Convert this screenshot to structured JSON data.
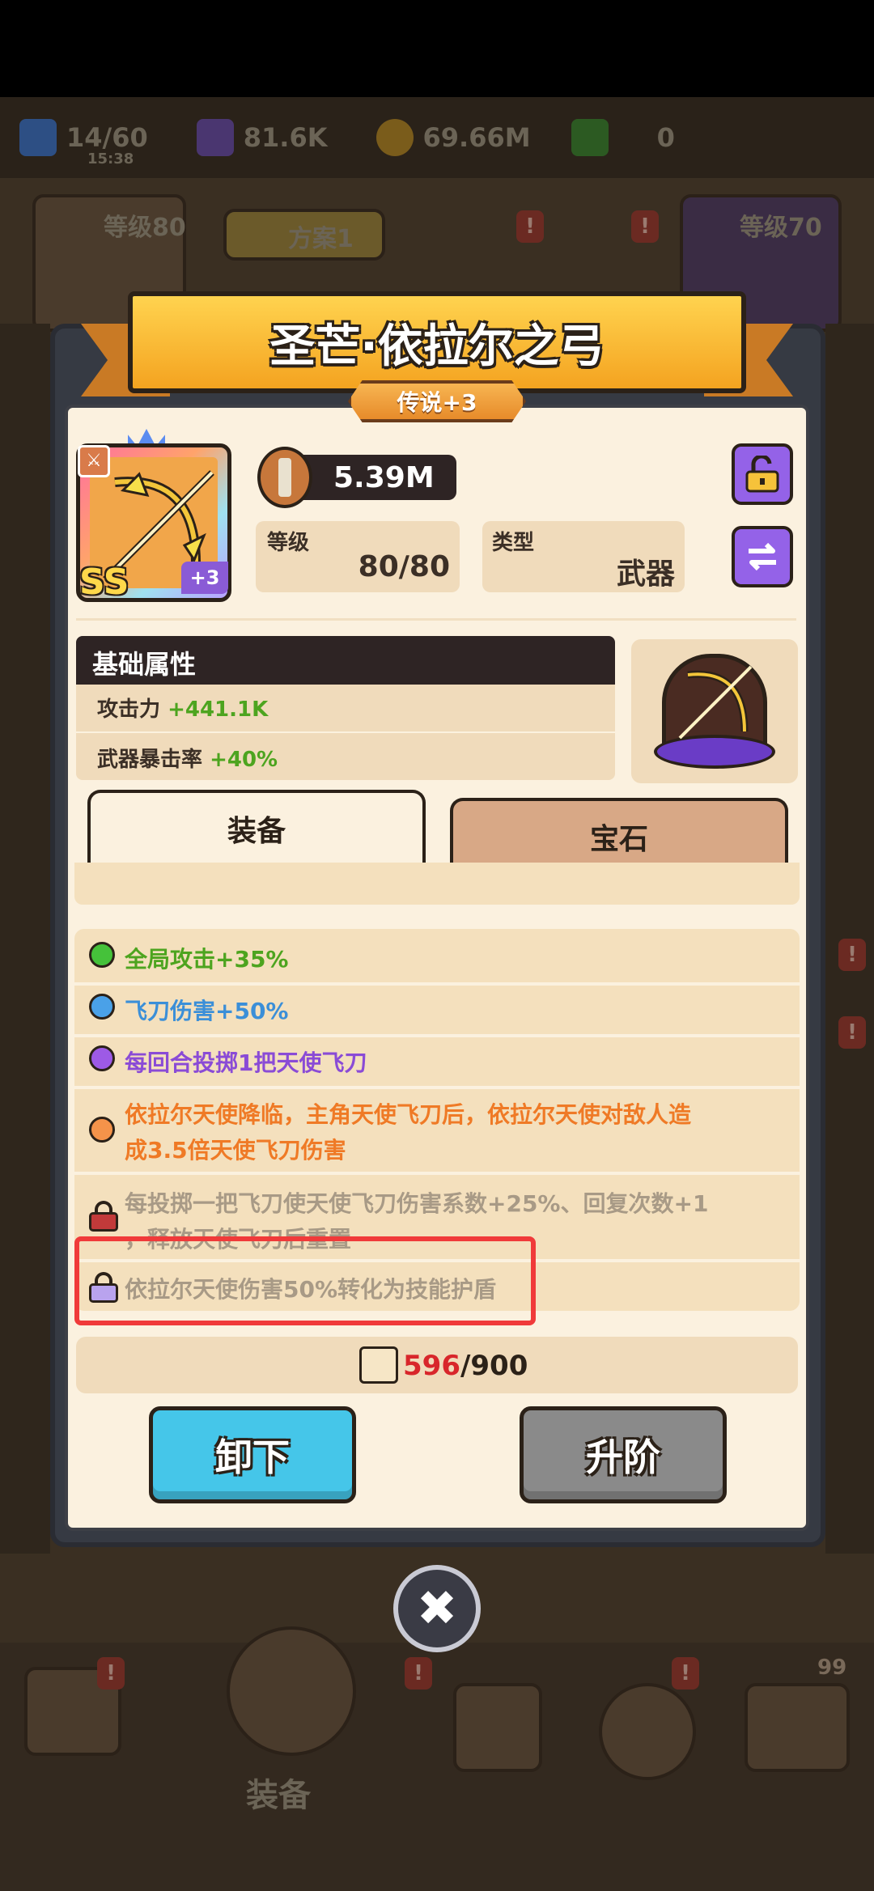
{
  "resources": [
    {
      "icon": "energy-icon",
      "value": "14/60",
      "sub": "15:38",
      "color": "#3f7fd6"
    },
    {
      "icon": "purple-gem-icon",
      "value": "81.6K",
      "color": "#6a4aa0"
    },
    {
      "icon": "gold-coin-icon",
      "value": "69.66M",
      "color": "#c9961e"
    },
    {
      "icon": "green-gem-icon",
      "value": "0",
      "color": "#3f9a2a"
    }
  ],
  "background": {
    "level_left": "等级80",
    "plan": "方案1",
    "level_right": "等级70",
    "nav_label": "装备",
    "nav_count": "99"
  },
  "item": {
    "title": "圣芒·依拉尔之弓",
    "rarity": "传说+3",
    "grade": "SS",
    "plus": "+3",
    "power": "5.39M",
    "level_label": "等级",
    "level_value": "80/80",
    "type_label": "类型",
    "type_value": "武器"
  },
  "attributes": {
    "header": "基础属性",
    "rows": [
      {
        "label": "攻击力",
        "value": "+441.1K"
      },
      {
        "label": "武器暴击率",
        "value": "+40%"
      }
    ]
  },
  "tabs": [
    "装备",
    "宝石"
  ],
  "skills": [
    {
      "text": "全局攻击+35%",
      "color": "#4da41f",
      "dot": "#45c23a",
      "state": "active"
    },
    {
      "text": "飞刀伤害+50%",
      "color": "#3b8fd8",
      "dot": "#4aa1e8",
      "state": "active"
    },
    {
      "text": "每回合投掷1把天使飞刀",
      "color": "#8a4bd6",
      "dot": "#9d5ae6",
      "state": "active"
    },
    {
      "text_line1": "依拉尔天使降临，主角天使飞刀后，依拉尔天使对敌人造",
      "text_line2": "成3.5倍天使飞刀伤害",
      "color": "#ef7a26",
      "dot": "#f4934a",
      "state": "active"
    },
    {
      "text_line1": "每投掷一把飞刀使天使飞刀伤害系数+25%、回复次数+1",
      "text_line2": "，释放天使飞刀后重置",
      "color": "#a89a86",
      "lock": "#c23a3a",
      "state": "locked"
    },
    {
      "text": "依拉尔天使伤害50%转化为技能护盾",
      "color": "#a89a86",
      "lock": "#b9a3ee",
      "state": "locked"
    }
  ],
  "material": {
    "current": "596",
    "total": "/900"
  },
  "buttons": {
    "unequip": "卸下",
    "upgrade": "升阶",
    "close": "✖"
  }
}
